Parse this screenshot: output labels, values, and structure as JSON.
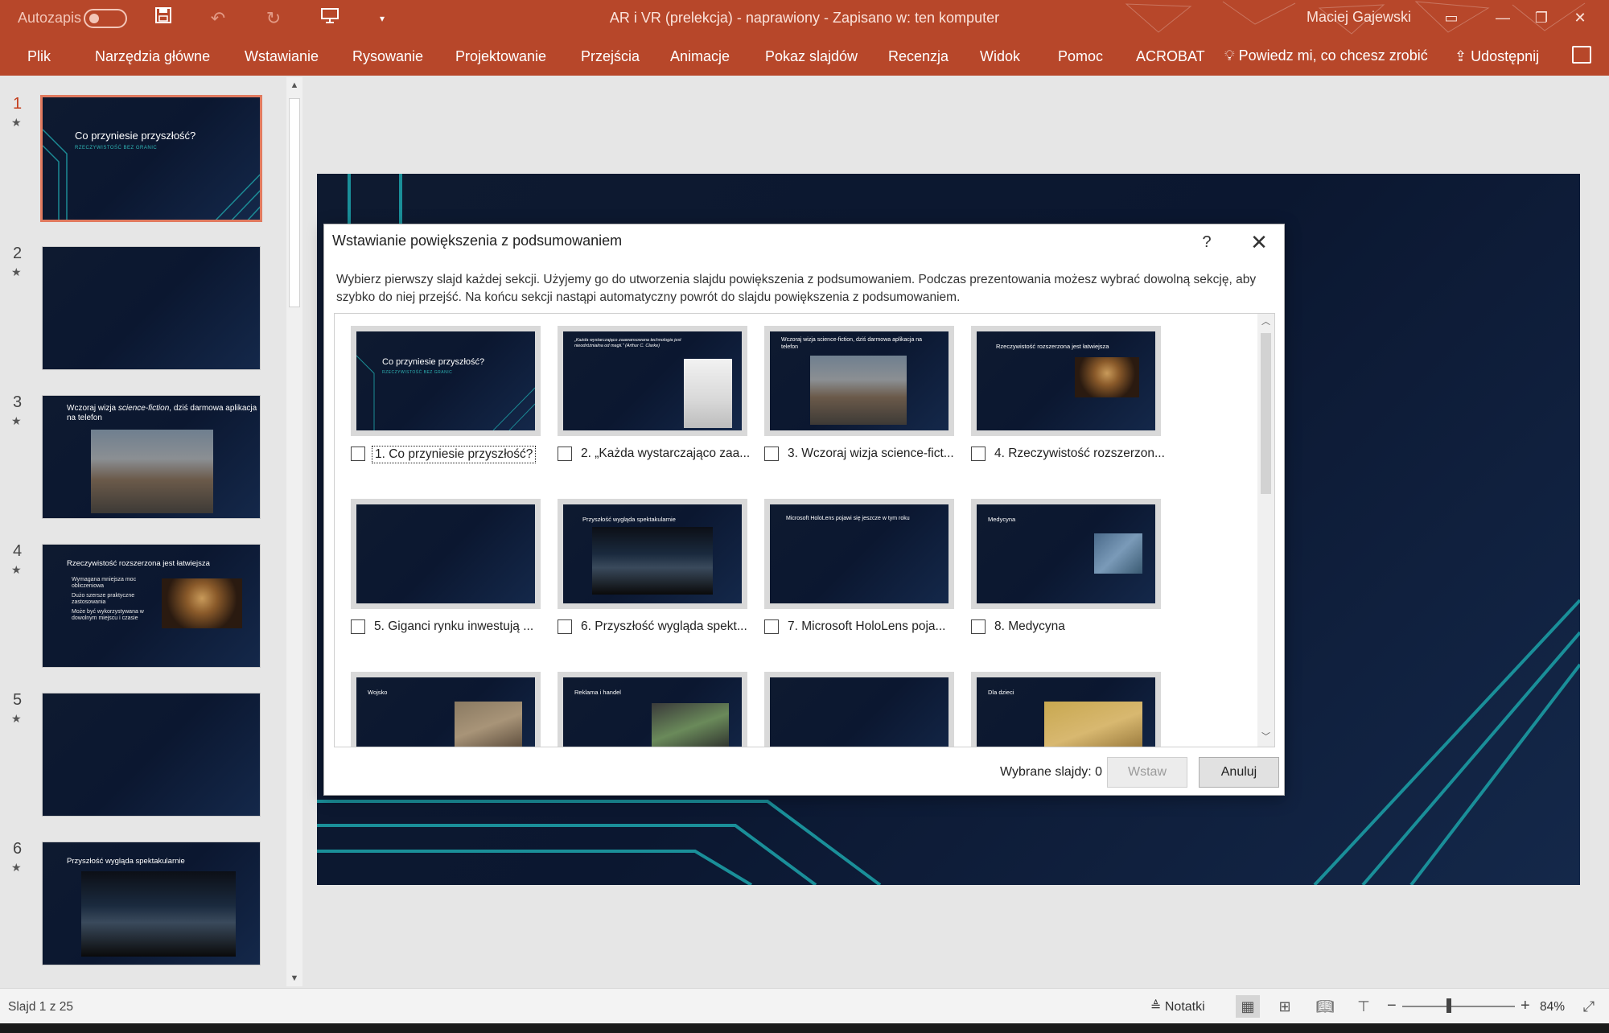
{
  "window": {
    "autosave_label": "Autozapis",
    "title": "AR i VR (prelekcja)  -  naprawiony  -  Zapisano w: ten komputer",
    "user": "Maciej Gajewski",
    "accent_color": "#b7472a"
  },
  "ribbon": {
    "tabs": [
      "Plik",
      "Narzędzia główne",
      "Wstawianie",
      "Rysowanie",
      "Projektowanie",
      "Przejścia",
      "Animacje",
      "Pokaz slajdów",
      "Recenzja",
      "Widok",
      "Pomoc",
      "ACROBAT"
    ],
    "tell_me": "Powiedz mi, co chcesz zrobić",
    "share": "Udostępnij"
  },
  "thumbnails": [
    {
      "number": "1",
      "title": "Co przyniesie przyszłość?",
      "subtitle": "RZECZYWISTOŚĆ BEZ GRANIC",
      "selected": true
    },
    {
      "number": "2",
      "title": "",
      "subtitle": ""
    },
    {
      "number": "3",
      "title_a": "Wczoraj wizja ",
      "title_em": "science-fiction",
      "title_b": ", dziś darmowa aplikacja na telefon"
    },
    {
      "number": "4",
      "title": "Rzeczywistość rozszerzona jest łatwiejsza",
      "bullets": [
        "Wymagana mniejsza moc obliczeniowa",
        "Dużo szersze praktyczne zastosowania",
        "Może być wykorzystywana w dowolnym miejscu i czasie"
      ]
    },
    {
      "number": "5",
      "title": "",
      "subtitle": ""
    },
    {
      "number": "6",
      "title": "Przyszłość wygląda spektakularnie"
    }
  ],
  "dialog": {
    "title": "Wstawianie powiększenia z podsumowaniem",
    "help": "?",
    "description": "Wybierz pierwszy slajd każdej sekcji. Użyjemy go do utworzenia slajdu powiększenia z podsumowaniem. Podczas prezentowania możesz wybrać dowolną sekcję, aby szybko do niej przejść. Na końcu sekcji nastąpi automatyczny powrót do slajdu powiększenia z podsumowaniem.",
    "cards": [
      {
        "label": "1. Co przyniesie przyszłość?",
        "slide_title": "Co przyniesie przyszłość?",
        "slide_sub": "RZECZYWISTOŚĆ BEZ GRANIC",
        "checked": false
      },
      {
        "label": "2. „Każda wystarczająco zaa...",
        "slide_title": "„Każda wystarczająco zaawansowana technologia jest nieodróżnialna od magii.” (Arthur C. Clarke)",
        "checked": false
      },
      {
        "label": "3. Wczoraj wizja science-fict...",
        "slide_title": "Wczoraj wizja science-fiction, dziś darmowa aplikacja na telefon",
        "checked": false
      },
      {
        "label": "4. Rzeczywistość rozszerzon...",
        "slide_title": "Rzeczywistość rozszerzona jest łatwiejsza",
        "checked": false
      },
      {
        "label": "5. Giganci rynku inwestują ...",
        "slide_title": "",
        "checked": false
      },
      {
        "label": "6. Przyszłość wygląda spekt...",
        "slide_title": "Przyszłość wygląda spektakularnie",
        "checked": false
      },
      {
        "label": "7. Microsoft HoloLens poja...",
        "slide_title": "Microsoft HoloLens pojawi się jeszcze w tym roku",
        "checked": false
      },
      {
        "label": "8. Medycyna",
        "slide_title": "Medycyna",
        "checked": false
      },
      {
        "label": "",
        "slide_title": "Wojsko",
        "checked": false
      },
      {
        "label": "",
        "slide_title": "Reklama i handel",
        "checked": false
      },
      {
        "label": "",
        "slide_title": "",
        "checked": false
      },
      {
        "label": "",
        "slide_title": "Dla dzieci",
        "checked": false
      }
    ],
    "selected_count": "Wybrane slajdy: 0",
    "insert_button": "Wstaw",
    "cancel_button": "Anuluj"
  },
  "statusbar": {
    "slide_info": "Slajd 1 z 25",
    "notes": "Notatki",
    "zoom": "84%",
    "zoom_level_percent": 84
  }
}
